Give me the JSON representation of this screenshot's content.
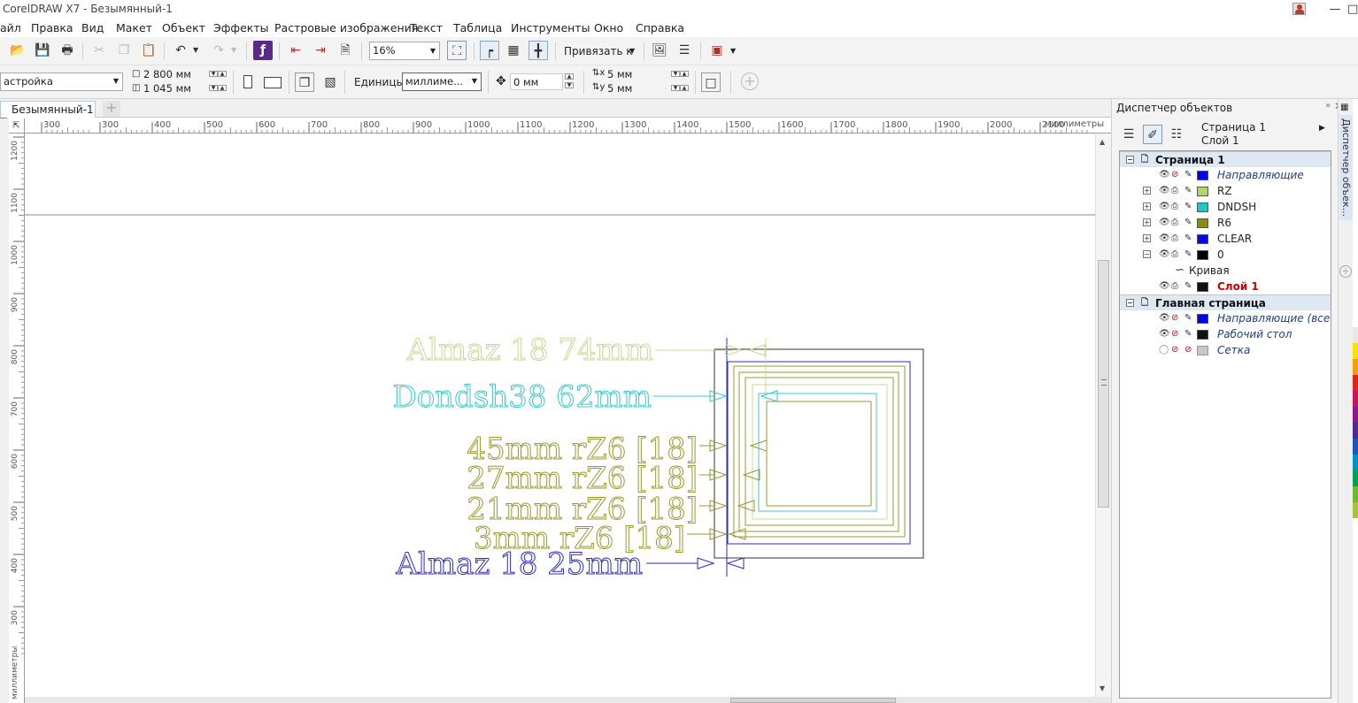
{
  "app": {
    "title": "CorelDRAW X7 - Безымянный-1"
  },
  "menu": [
    "айл",
    "Правка",
    "Вид",
    "Макет",
    "Объект",
    "Эффекты",
    "Растровые изображения",
    "Текст",
    "Таблица",
    "Инструменты",
    "Окно",
    "Справка"
  ],
  "toolbar": {
    "zoom": "16%",
    "snap_label": "Привязать к"
  },
  "property_bar": {
    "preset": "астройка",
    "width": "2 800 мм",
    "height": "1 045 мм",
    "units_label": "Единицы:",
    "units_value": "миллиме...",
    "nudge": "0 мм",
    "dup_x": "5 мм",
    "dup_y": "5 мм"
  },
  "document_tab": {
    "name": "Безымянный-1"
  },
  "ruler": {
    "h_ticks": [
      "300",
      "300",
      "400",
      "500",
      "600",
      "700",
      "800",
      "900",
      "1000",
      "1100",
      "1200",
      "1300",
      "1400",
      "1500",
      "1600",
      "1700",
      "1800",
      "1900",
      "2000",
      "2100"
    ],
    "h_unit": "миллиметры",
    "v_ticks": [
      "1200",
      "1100",
      "1000",
      "900",
      "800",
      "700",
      "600",
      "500",
      "400",
      "300"
    ],
    "v_unit": "миллиметры"
  },
  "drawing": {
    "labels": [
      {
        "text": "Almaz 18 74mm",
        "color": "#c8d890"
      },
      {
        "text": "Dondsh38 62mm",
        "color": "#3cc8cc"
      },
      {
        "text": "45mm rZ6 [18]",
        "color": "#9a9a30"
      },
      {
        "text": "27mm rZ6 [18]",
        "color": "#9a9a30"
      },
      {
        "text": "21mm rZ6 [18]",
        "color": "#9a9a30"
      },
      {
        "text": "3mm rZ6 [18]",
        "color": "#9a9a30"
      },
      {
        "text": "Almaz 18 25mm",
        "color": "#2b2bc8"
      }
    ]
  },
  "object_manager": {
    "title": "Диспетчер объектов",
    "page": "Страница 1",
    "layer": "Слой 1",
    "side_tab": "Диспетчер объек...",
    "rows": [
      {
        "type": "header",
        "label": "Страница 1"
      },
      {
        "type": "layer",
        "label": "Направляющие",
        "style": "it",
        "color": "#0000ee"
      },
      {
        "type": "layer",
        "label": "RZ",
        "style": "plain",
        "color": "#b4d46a"
      },
      {
        "type": "layer",
        "label": "DNDSH",
        "style": "plain",
        "color": "#1fc8c8"
      },
      {
        "type": "layer",
        "label": "R6",
        "style": "plain",
        "color": "#8a8a14"
      },
      {
        "type": "layer",
        "label": "CLEAR",
        "style": "plain",
        "color": "#0a0ae6"
      },
      {
        "type": "layer",
        "label": "0",
        "style": "plain",
        "color": "#000000"
      },
      {
        "type": "object",
        "label": "Кривая"
      },
      {
        "type": "layer",
        "label": "Слой 1",
        "style": "red",
        "color": "#111111"
      },
      {
        "type": "header",
        "label": "Главная страница"
      },
      {
        "type": "layer",
        "label": "Направляющие (все ст",
        "style": "it",
        "color": "#0000ee"
      },
      {
        "type": "layer",
        "label": "Рабочий стол",
        "style": "it",
        "color": "#111111"
      },
      {
        "type": "layer",
        "label": "Сетка",
        "style": "it",
        "color": "#c8c8c8"
      }
    ]
  },
  "palette_colors": [
    "#ffffff",
    "#e8e8e8",
    "#f7e300",
    "#f2a200",
    "#e0231c",
    "#c2185b",
    "#8b1a8b",
    "#4a2d8f",
    "#1a57b8",
    "#0093c8",
    "#00a352",
    "#6aba2c",
    "#a6c43a"
  ]
}
